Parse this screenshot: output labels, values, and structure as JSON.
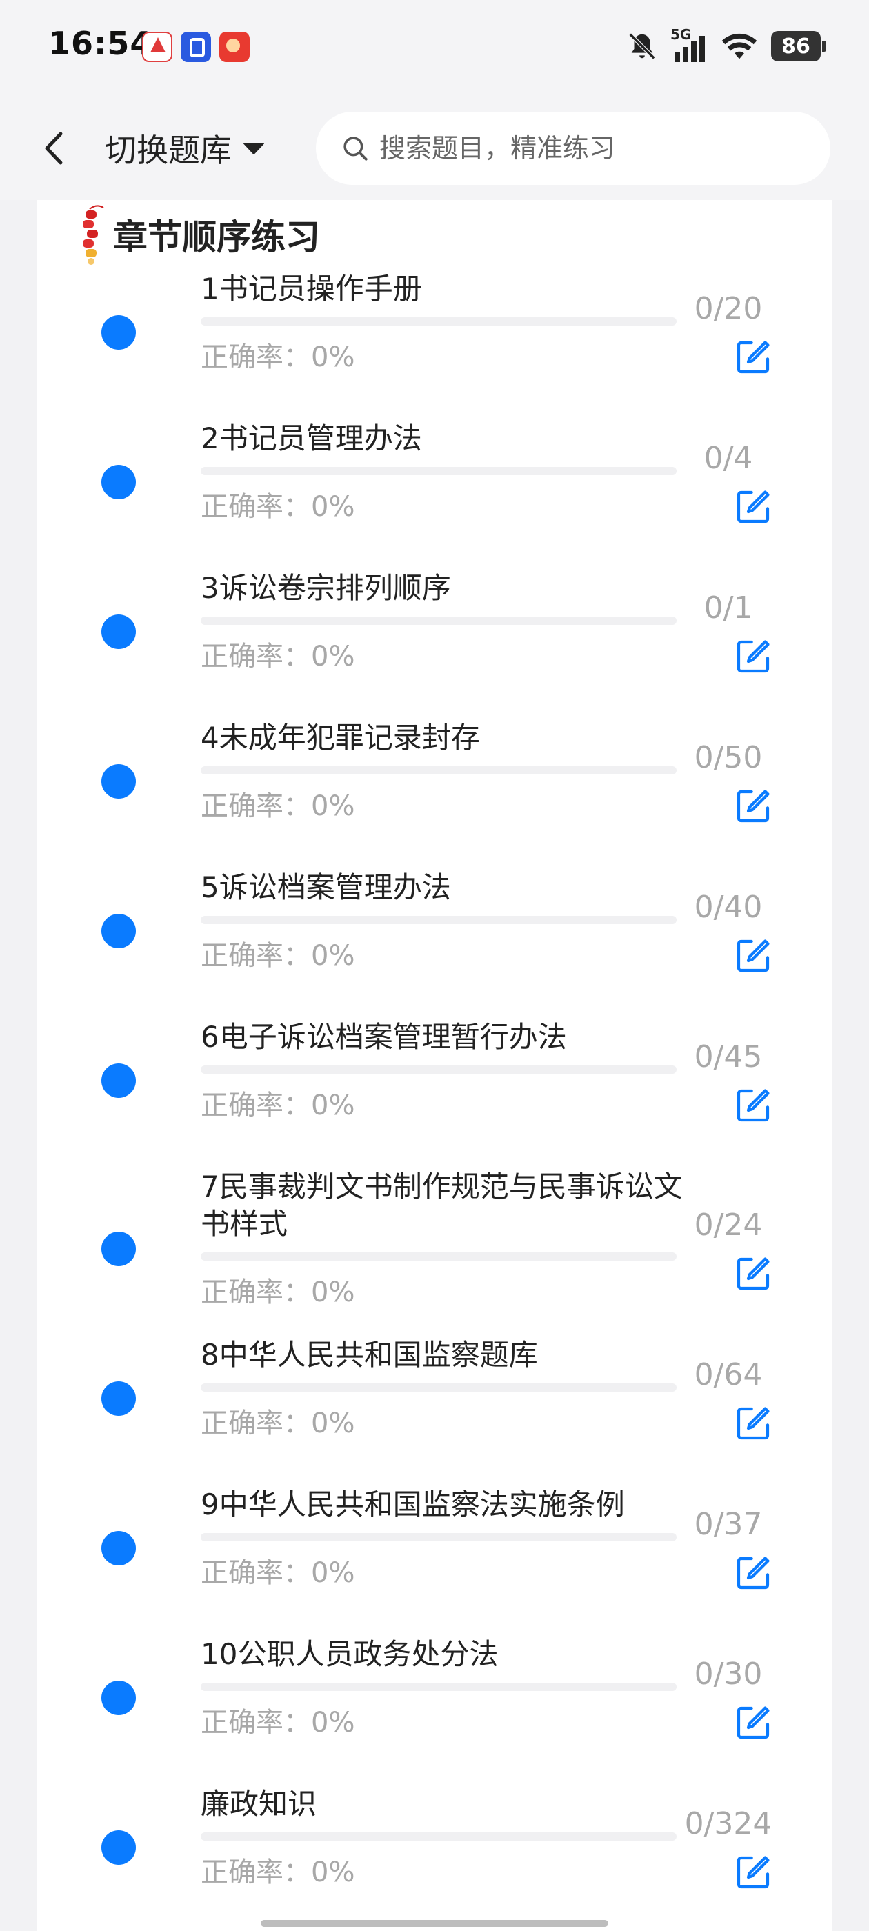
{
  "status_bar": {
    "time": "16:54",
    "network": "5G",
    "battery": "86",
    "icons": [
      "app-notification-icon-1",
      "app-notification-icon-2",
      "app-notification-icon-3",
      "mute-bell-icon",
      "signal-icon",
      "wifi-icon",
      "battery-icon"
    ]
  },
  "header": {
    "back_icon": "chevron-left-icon",
    "switch_label": "切换题库",
    "dropdown_icon": "caret-down-icon",
    "search_placeholder": "搜索题目，精准练习",
    "search_icon": "search-icon"
  },
  "section": {
    "title": "章节顺序练习",
    "title_icon": "firecracker-icon"
  },
  "accent_color": "#0a7bff",
  "chapters": [
    {
      "title": "1书记员操作手册",
      "accuracy": "正确率：0%",
      "count": "0/20",
      "progress": 0
    },
    {
      "title": "2书记员管理办法",
      "accuracy": "正确率：0%",
      "count": "0/4",
      "progress": 0
    },
    {
      "title": "3诉讼卷宗排列顺序",
      "accuracy": "正确率：0%",
      "count": "0/1",
      "progress": 0
    },
    {
      "title": "4未成年犯罪记录封存",
      "accuracy": "正确率：0%",
      "count": "0/50",
      "progress": 0
    },
    {
      "title": "5诉讼档案管理办法",
      "accuracy": "正确率：0%",
      "count": "0/40",
      "progress": 0
    },
    {
      "title": "6电子诉讼档案管理暂行办法",
      "accuracy": "正确率：0%",
      "count": "0/45",
      "progress": 0
    },
    {
      "title": "7民事裁判文书制作规范与民事诉讼文书样式",
      "accuracy": "正确率：0%",
      "count": "0/24",
      "progress": 0
    },
    {
      "title": "8中华人民共和国监察题库",
      "accuracy": "正确率：0%",
      "count": "0/64",
      "progress": 0
    },
    {
      "title": "9中华人民共和国监察法实施条例",
      "accuracy": "正确率：0%",
      "count": "0/37",
      "progress": 0
    },
    {
      "title": "10公职人员政务处分法",
      "accuracy": "正确率：0%",
      "count": "0/30",
      "progress": 0
    },
    {
      "title": "廉政知识",
      "accuracy": "正确率：0%",
      "count": "0/324",
      "progress": 0
    }
  ]
}
